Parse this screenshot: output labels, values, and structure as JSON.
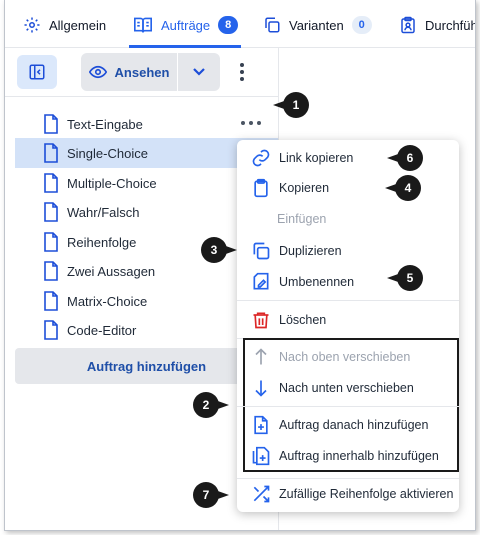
{
  "tabs": [
    {
      "label": "Allgemein",
      "icon": "gear-icon"
    },
    {
      "label": "Aufträge",
      "icon": "book-icon",
      "count": "8",
      "active": true
    },
    {
      "label": "Varianten",
      "icon": "copy-icon",
      "count": "0"
    },
    {
      "label": "Durchführ",
      "icon": "clipboard-user-icon"
    }
  ],
  "toolbar": {
    "view_label": "Ansehen"
  },
  "tree": {
    "items": [
      {
        "label": "Text-Eingabe"
      },
      {
        "label": "Single-Choice",
        "selected": true
      },
      {
        "label": "Multiple-Choice"
      },
      {
        "label": "Wahr/Falsch"
      },
      {
        "label": "Reihenfolge"
      },
      {
        "label": "Zwei Aussagen"
      },
      {
        "label": "Matrix-Choice"
      },
      {
        "label": "Code-Editor"
      }
    ],
    "add_label": "Auftrag hinzufügen"
  },
  "menu": {
    "items": {
      "link": "Link kopieren",
      "copy": "Kopieren",
      "paste": "Einfügen",
      "duplicate": "Duplizieren",
      "rename": "Umbenennen",
      "delete": "Löschen",
      "move_up": "Nach oben verschieben",
      "move_down": "Nach unten verschieben",
      "add_after": "Auftrag danach hinzufügen",
      "add_inside": "Auftrag innerhalb hinzufügen",
      "shuffle": "Zufällige Reihenfolge aktivieren"
    }
  },
  "callouts": [
    "1",
    "2",
    "3",
    "4",
    "5",
    "6",
    "7"
  ],
  "colors": {
    "accent": "#2563eb",
    "selected_row": "#d3e2f8",
    "danger": "#dc2626",
    "callout": "#1a1a1a"
  }
}
